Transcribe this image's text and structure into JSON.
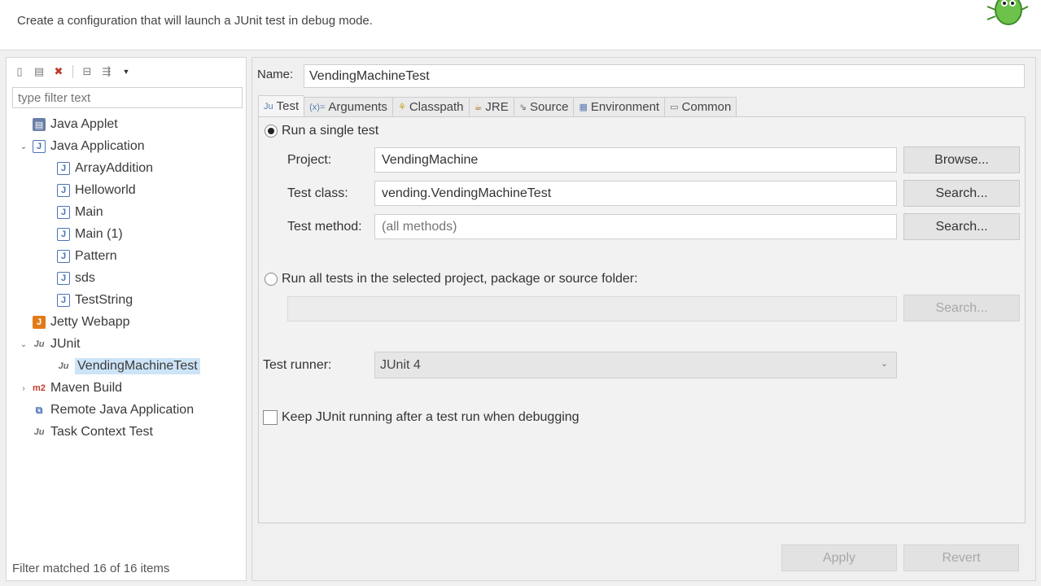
{
  "header": {
    "description": "Create a configuration that will launch a JUnit test in debug mode."
  },
  "left": {
    "filter_placeholder": "type filter text",
    "tree": [
      {
        "label": "Java Applet",
        "icon": "java-applet-icon"
      },
      {
        "label": "Java Application",
        "icon": "java-application-icon",
        "expanded": true
      },
      {
        "label": "ArrayAddition",
        "icon": "java-application-icon"
      },
      {
        "label": "Helloworld",
        "icon": "java-application-icon"
      },
      {
        "label": "Main",
        "icon": "java-application-icon"
      },
      {
        "label": "Main (1)",
        "icon": "java-application-icon"
      },
      {
        "label": "Pattern",
        "icon": "java-application-icon"
      },
      {
        "label": "sds",
        "icon": "java-application-icon"
      },
      {
        "label": "TestString",
        "icon": "java-application-icon"
      },
      {
        "label": "Jetty Webapp",
        "icon": "jetty-icon"
      },
      {
        "label": "JUnit",
        "icon": "junit-icon",
        "expanded": true
      },
      {
        "label": "VendingMachineTest",
        "icon": "junit-icon",
        "selected": true
      },
      {
        "label": "Maven Build",
        "icon": "maven-icon",
        "expanded": false
      },
      {
        "label": "Remote Java Application",
        "icon": "remote-java-icon"
      },
      {
        "label": "Task Context Test",
        "icon": "task-context-icon"
      }
    ],
    "status": "Filter matched 16 of 16 items"
  },
  "config": {
    "name_label": "Name:",
    "name_value": "VendingMachineTest",
    "tabs": [
      {
        "label": "Test",
        "icon": "junit-icon",
        "active": true
      },
      {
        "label": "Arguments",
        "icon": "arguments-icon"
      },
      {
        "label": "Classpath",
        "icon": "classpath-icon"
      },
      {
        "label": "JRE",
        "icon": "jre-icon"
      },
      {
        "label": "Source",
        "icon": "source-icon"
      },
      {
        "label": "Environment",
        "icon": "environment-icon"
      },
      {
        "label": "Common",
        "icon": "common-icon"
      }
    ],
    "run_single_label": "Run a single test",
    "project_label": "Project:",
    "project_value": "VendingMachine",
    "browse_label": "Browse...",
    "test_class_label": "Test class:",
    "test_class_value": "vending.VendingMachineTest",
    "search_label": "Search...",
    "test_method_label": "Test method:",
    "test_method_placeholder": "(all methods)",
    "run_all_label": "Run all tests in the selected project, package or source folder:",
    "test_runner_label": "Test runner:",
    "test_runner_value": "JUnit 4",
    "keep_running_label": "Keep JUnit running after a test run when debugging",
    "apply_label": "Apply",
    "revert_label": "Revert"
  }
}
